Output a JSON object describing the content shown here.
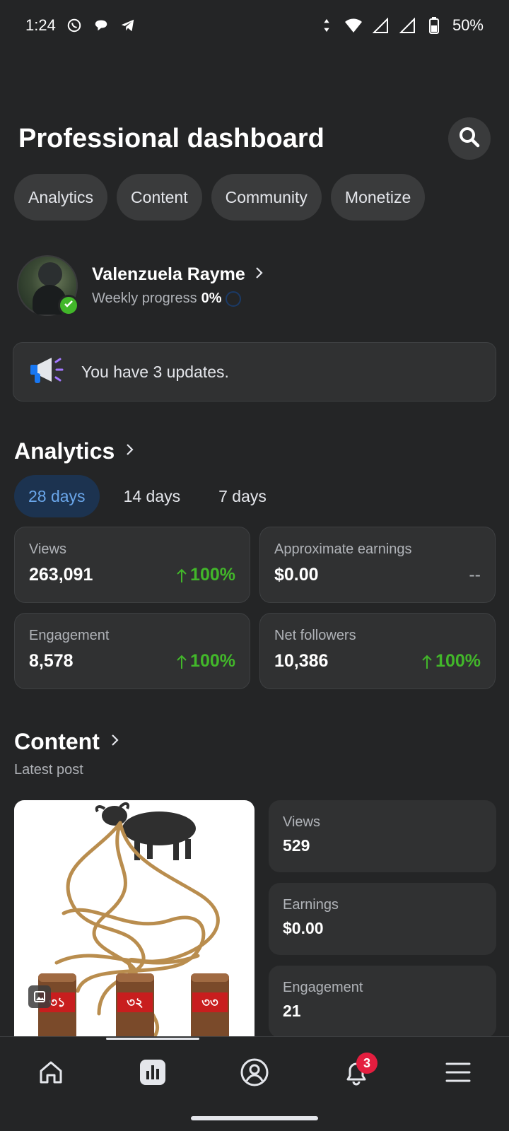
{
  "status_bar": {
    "time": "1:24",
    "battery": "50%",
    "icons": [
      "whatsapp-icon",
      "chat-icon",
      "telegram-icon",
      "data-arrows-icon",
      "wifi-icon",
      "signal-icon",
      "signal-icon",
      "battery-icon"
    ]
  },
  "header": {
    "title": "Professional dashboard",
    "search_icon": "search-icon"
  },
  "tabs": [
    {
      "label": "Analytics"
    },
    {
      "label": "Content"
    },
    {
      "label": "Community"
    },
    {
      "label": "Monetize"
    }
  ],
  "profile": {
    "name": "Valenzuela Rayme",
    "progress_label": "Weekly progress",
    "progress_value": "0%"
  },
  "updates": {
    "text": "You have 3 updates.",
    "icon": "megaphone-icon"
  },
  "analytics": {
    "title": "Analytics",
    "ranges": [
      {
        "label": "28 days",
        "active": true
      },
      {
        "label": "14 days",
        "active": false
      },
      {
        "label": "7 days",
        "active": false
      }
    ],
    "stats": [
      {
        "label": "Views",
        "value": "263,091",
        "change": "100%"
      },
      {
        "label": "Approximate earnings",
        "value": "$0.00",
        "change": "--"
      },
      {
        "label": "Engagement",
        "value": "8,578",
        "change": "100%"
      },
      {
        "label": "Net followers",
        "value": "10,386",
        "change": "100%"
      }
    ]
  },
  "content": {
    "title": "Content",
    "subtitle": "Latest post",
    "post_stats": [
      {
        "label": "Views",
        "value": "529"
      },
      {
        "label": "Earnings",
        "value": "$0.00"
      },
      {
        "label": "Engagement",
        "value": "21"
      }
    ],
    "post_image_labels": [
      "৩১",
      "৩২",
      "৩৩"
    ]
  },
  "bottom_nav": {
    "items": [
      "home-icon",
      "dashboard-icon",
      "profile-icon",
      "notifications-icon",
      "menu-icon"
    ],
    "notification_count": "3"
  },
  "colors": {
    "background": "#242526",
    "card": "#303132",
    "accent_blue": "#6aa6ea",
    "positive_green": "#42b72a",
    "badge_red": "#e41e3f"
  }
}
